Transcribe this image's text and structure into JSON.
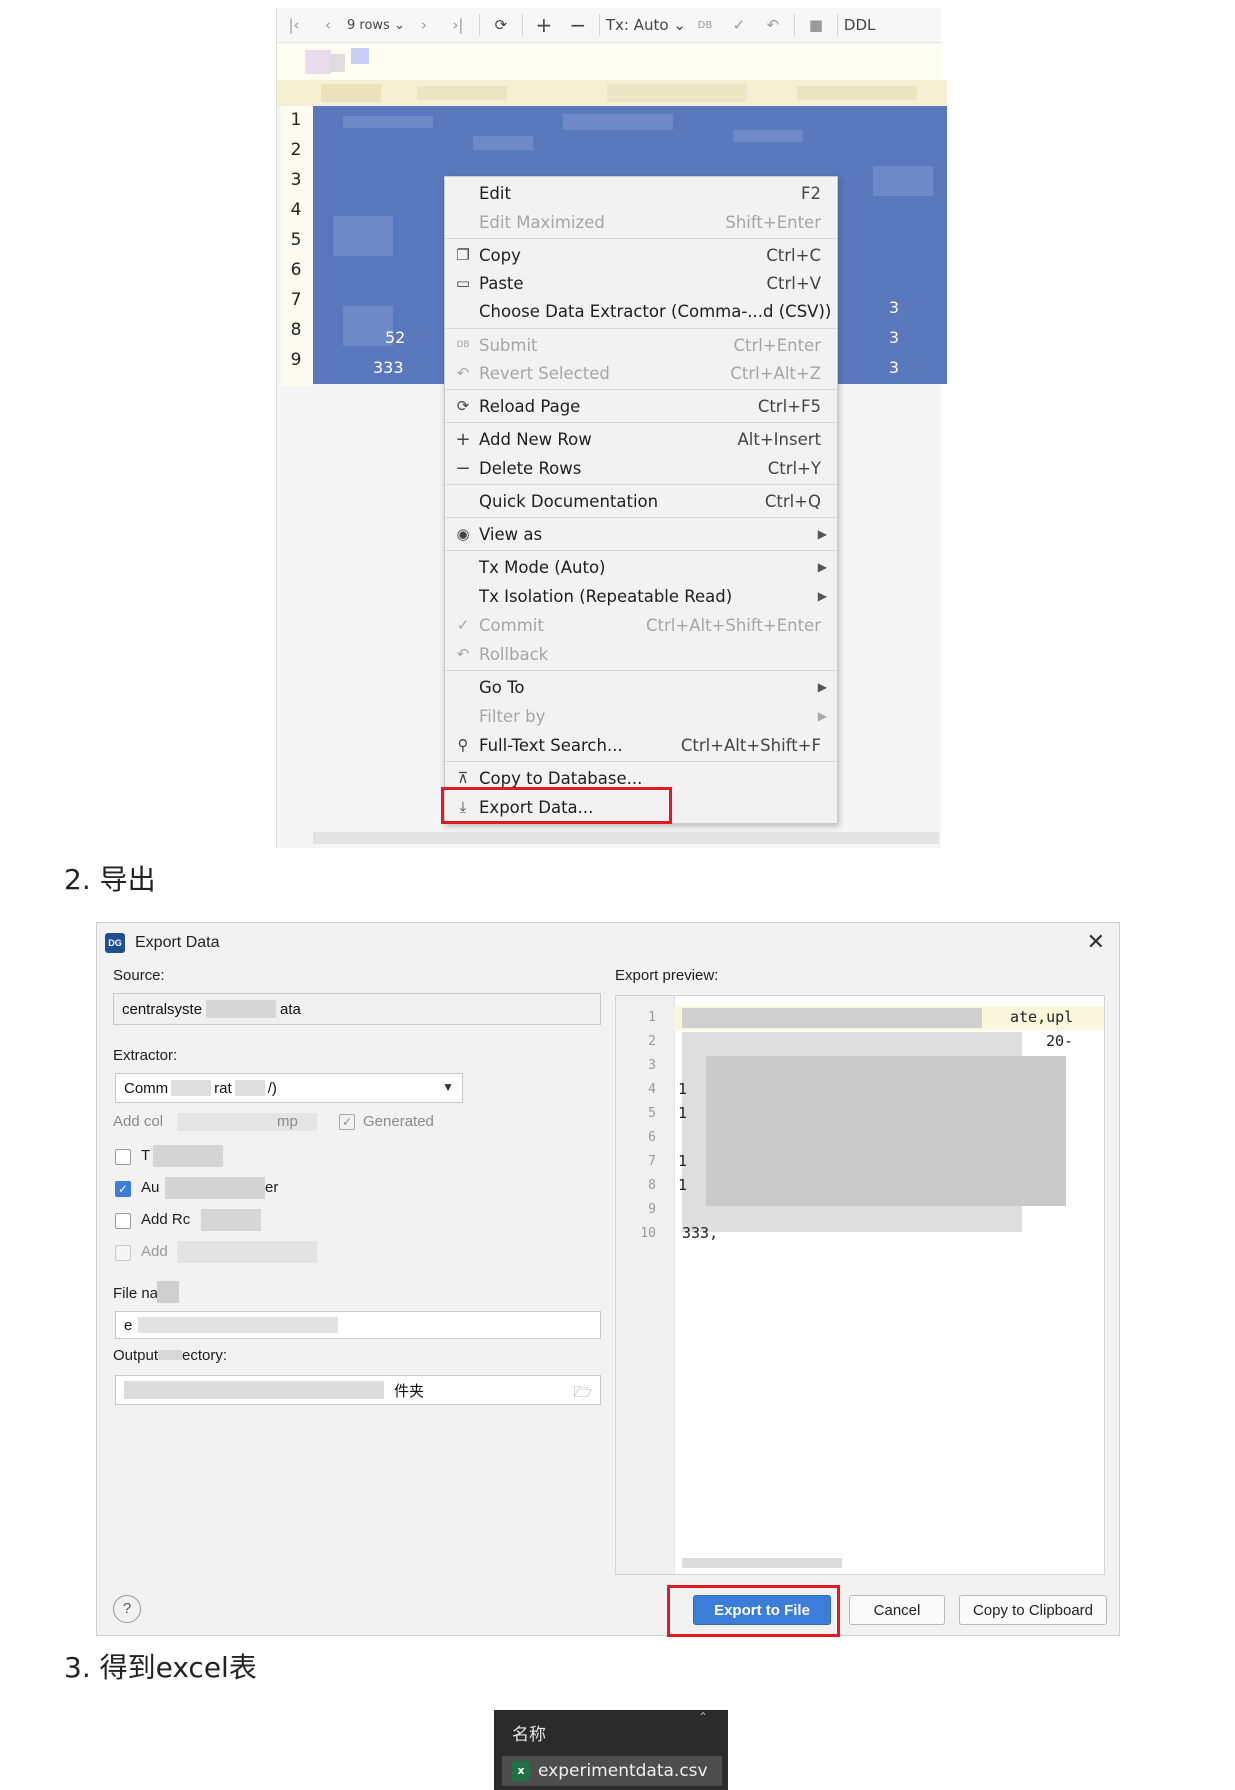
{
  "grid": {
    "toolbar": {
      "rows_label": "9 rows",
      "tx_label": "Tx: Auto",
      "ddl_label": "DDL"
    },
    "row_numbers": [
      "1",
      "2",
      "3",
      "4",
      "5",
      "6",
      "7",
      "8",
      "9"
    ],
    "visible_cells": {
      "row8_left": "52",
      "row9_left": "333",
      "row7_right": "3",
      "row8_right": "3",
      "row9_right": "3"
    }
  },
  "context_menu": {
    "items": [
      {
        "label": "Edit",
        "shortcut": "F2",
        "icon": "",
        "disabled": false
      },
      {
        "label": "Edit Maximized",
        "shortcut": "Shift+Enter",
        "icon": "",
        "disabled": true
      },
      {
        "label": "Copy",
        "shortcut": "Ctrl+C",
        "icon": "copy-icon",
        "disabled": false
      },
      {
        "label": "Paste",
        "shortcut": "Ctrl+V",
        "icon": "paste-icon",
        "disabled": false
      },
      {
        "label": "Choose Data Extractor (Comma-...d (CSV))",
        "shortcut": "",
        "icon": "",
        "disabled": false
      },
      {
        "label": "Submit",
        "shortcut": "Ctrl+Enter",
        "icon": "db-submit-icon",
        "disabled": true
      },
      {
        "label": "Revert Selected",
        "shortcut": "Ctrl+Alt+Z",
        "icon": "revert-icon",
        "disabled": true
      },
      {
        "label": "Reload Page",
        "shortcut": "Ctrl+F5",
        "icon": "reload-icon",
        "disabled": false
      },
      {
        "label": "Add New Row",
        "shortcut": "Alt+Insert",
        "icon": "plus-icon",
        "disabled": false
      },
      {
        "label": "Delete Rows",
        "shortcut": "Ctrl+Y",
        "icon": "minus-icon",
        "disabled": false
      },
      {
        "label": "Quick Documentation",
        "shortcut": "Ctrl+Q",
        "icon": "",
        "disabled": false
      },
      {
        "label": "View as",
        "shortcut": "",
        "icon": "eye-icon",
        "disabled": false,
        "submenu": true
      },
      {
        "label": "Tx Mode (Auto)",
        "shortcut": "",
        "icon": "",
        "disabled": false,
        "submenu": true
      },
      {
        "label": "Tx Isolation (Repeatable Read)",
        "shortcut": "",
        "icon": "",
        "disabled": false,
        "submenu": true
      },
      {
        "label": "Commit",
        "shortcut": "Ctrl+Alt+Shift+Enter",
        "icon": "check-icon",
        "disabled": true
      },
      {
        "label": "Rollback",
        "shortcut": "",
        "icon": "rollback-icon",
        "disabled": true
      },
      {
        "label": "Go To",
        "shortcut": "",
        "icon": "",
        "disabled": false,
        "submenu": true
      },
      {
        "label": "Filter by",
        "shortcut": "",
        "icon": "",
        "disabled": true,
        "submenu": true
      },
      {
        "label": "Full-Text Search...",
        "shortcut": "Ctrl+Alt+Shift+F",
        "icon": "search-icon",
        "disabled": false
      },
      {
        "label": "Copy to Database...",
        "shortcut": "",
        "icon": "upload-icon",
        "disabled": false
      },
      {
        "label": "Export Data...",
        "shortcut": "",
        "icon": "download-icon",
        "disabled": false
      }
    ]
  },
  "steps": {
    "step2": "2. 导出",
    "step3": "3. 得到excel表"
  },
  "export_dialog": {
    "title": "Export Data",
    "source_label": "Source:",
    "source_value": "centralsyste",
    "source_value_tail": "ata",
    "extractor_label": "Extractor:",
    "extractor_value": "Comm",
    "extractor_value_mid": "rat",
    "extractor_value_tail": "/)",
    "add_columns_label": "Add col",
    "computed_label": "mp",
    "generated_label": "Generated",
    "checkbox1_label": "T",
    "checkbox2_label": "Au",
    "checkbox2_tail": "er",
    "checkbox3_label": "Add Rc",
    "checkbox4_label": "Add",
    "file_name_label": "File na",
    "file_name_value": "e",
    "output_dir_label": "Output",
    "output_dir_label_tail": "ectory:",
    "output_dir_value": "件夹",
    "preview_label": "Export preview:",
    "preview_line_numbers": [
      "1",
      "2",
      "3",
      "4",
      "5",
      "6",
      "7",
      "8",
      "9",
      "10"
    ],
    "preview_fragments": {
      "line1": "ate,upl",
      "line2": "20-",
      "line4": "1",
      "line5": "1",
      "line7": "1",
      "line8": "1",
      "line10": "333,"
    },
    "buttons": {
      "export_to_file": "Export to File",
      "cancel": "Cancel",
      "copy_to_clipboard": "Copy to Clipboard",
      "help": "?"
    }
  },
  "explorer": {
    "column_header": "名称",
    "file_name": "experimentdata.csv"
  }
}
